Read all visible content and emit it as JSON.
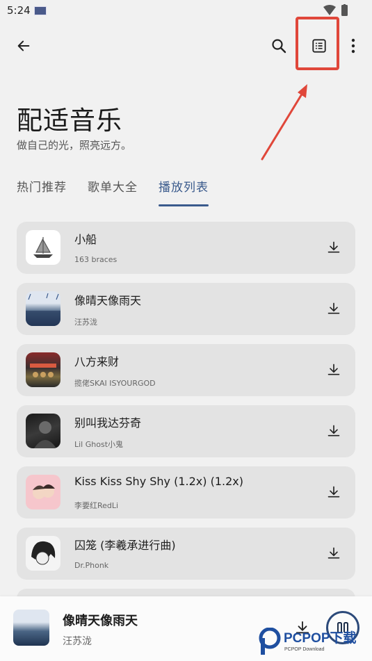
{
  "status_bar": {
    "time": "5:24"
  },
  "appbar": {
    "back_icon": "arrow-left-icon",
    "search_icon": "search-icon",
    "list_icon": "list-icon",
    "more_icon": "more-vertical-icon"
  },
  "header": {
    "title": "配适音乐",
    "subtitle": "做自己的光，照亮远方。"
  },
  "tabs": [
    {
      "label": "热门推荐",
      "active": false
    },
    {
      "label": "歌单大全",
      "active": false
    },
    {
      "label": "播放列表",
      "active": true
    }
  ],
  "songs": [
    {
      "title": "小船",
      "artist": "163 braces"
    },
    {
      "title": "像晴天像雨天",
      "artist": "汪苏泷"
    },
    {
      "title": "八方来财",
      "artist": "揽佬SKAI ISYOURGOD"
    },
    {
      "title": "别叫我达芬奇",
      "artist": "Lil Ghost小鬼"
    },
    {
      "title": "Kiss Kiss Shy Shy (1.2x) (1.2x)",
      "artist": "李要红RedLi"
    },
    {
      "title": "囚笼 (李羲承进行曲)",
      "artist": "Dr.Phonk"
    }
  ],
  "player": {
    "title": "像晴天像雨天",
    "artist": "汪苏泷",
    "state_icon": "pause-icon"
  },
  "watermark": {
    "brand": "PCPOP下载",
    "sub": "PCPOP Download"
  },
  "colors": {
    "accent": "#3a5a8c",
    "highlight": "#e0473a",
    "card": "#e3e3e3",
    "background": "#f1f1f1"
  }
}
